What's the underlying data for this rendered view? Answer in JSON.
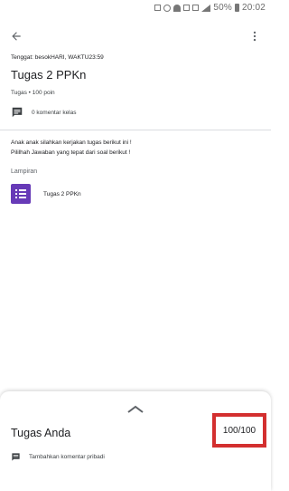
{
  "status_bar": {
    "battery": "50%",
    "time": "20:02"
  },
  "assignment": {
    "due": "Tenggat: besokHARI, WAKTU23:59",
    "title": "Tugas 2 PPKn",
    "meta": "Tugas • 100 poin",
    "class_comments": "0 komentar kelas",
    "instructions": [
      "Anak anak silahkan kerjakan tugas berikut ini !",
      "Pililhah Jawaban yang tepat dari soal berikut !"
    ],
    "attachments_label": "Lampiran",
    "attachment": {
      "name": "Tugas 2 PPKn",
      "icon": "google-forms-icon",
      "color": "#673ab7"
    }
  },
  "your_work": {
    "title": "Tugas Anda",
    "grade": "100/100",
    "add_comment": "Tambahkan komentar pribadi",
    "highlight_color": "#d32f2f"
  }
}
